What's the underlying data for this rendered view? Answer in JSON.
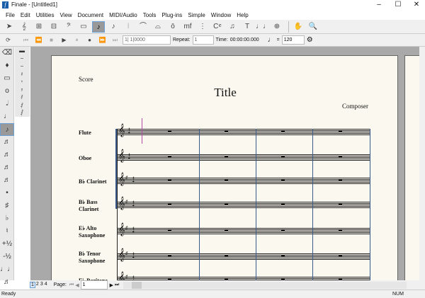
{
  "window": {
    "title": "Finale - [Untitled1]",
    "controls": [
      "–",
      "☐",
      "✕"
    ]
  },
  "menu": [
    "File",
    "Edit",
    "Utilities",
    "View",
    "Document",
    "MIDI/Audio",
    "Tools",
    "Plug-ins",
    "Simple",
    "Window",
    "Help"
  ],
  "toolbar1": [
    "➤",
    "𝄞",
    "⊞",
    "⊟",
    "𝄢",
    "▭",
    "♪",
    "♪",
    "𝄀",
    "⌒",
    "⌓",
    "ō",
    "mf",
    "⋮",
    "C𝄴",
    "♫",
    "T",
    "♩♩",
    "⊕",
    "✋",
    "🔍"
  ],
  "toolbar1_selected": 6,
  "playback": {
    "buttons": [
      "⟳",
      "⏮",
      "⏪",
      "■",
      "▶",
      "⏸",
      "●",
      "⏩",
      "⏭"
    ],
    "measure": "1| 1|0000",
    "repeat_label": "Repeat:",
    "repeat_value": "1",
    "time_label": "Time:",
    "time_value": "00:00:00.000",
    "tempo_eq": "=",
    "tempo": "120"
  },
  "palette1": [
    "⌫",
    "♦",
    "▭",
    "o",
    "𝅗𝅥",
    "♩",
    "♪",
    "♬",
    "♬",
    "♬",
    "♬",
    "•",
    "♯",
    "♭",
    "♮",
    "+½",
    "-½",
    "♩♩",
    "♬"
  ],
  "palette1_selected": 6,
  "palette2": [
    "▬",
    "−",
    "−",
    "𝄽",
    "𝄾",
    "𝄿",
    "𝅀",
    "𝅁",
    "𝅂"
  ],
  "score": {
    "label": "Score",
    "title": "Title",
    "composer": "Composer",
    "instruments": [
      [
        "Flute"
      ],
      [
        "Oboe"
      ],
      [
        "B♭ Clarinet"
      ],
      [
        "B♭ Bass",
        "Clarinet"
      ],
      [
        "E♭ Alto",
        "Saxophone"
      ],
      [
        "B♭ Tenor",
        "Saxophone"
      ],
      [
        "E♭ Baritone"
      ]
    ]
  },
  "pagenav": {
    "tabs": [
      "1",
      "2",
      "3",
      "4"
    ],
    "page_label": "Page:",
    "page_value": "1"
  },
  "status": {
    "text": "Ready",
    "num": "NUM"
  }
}
